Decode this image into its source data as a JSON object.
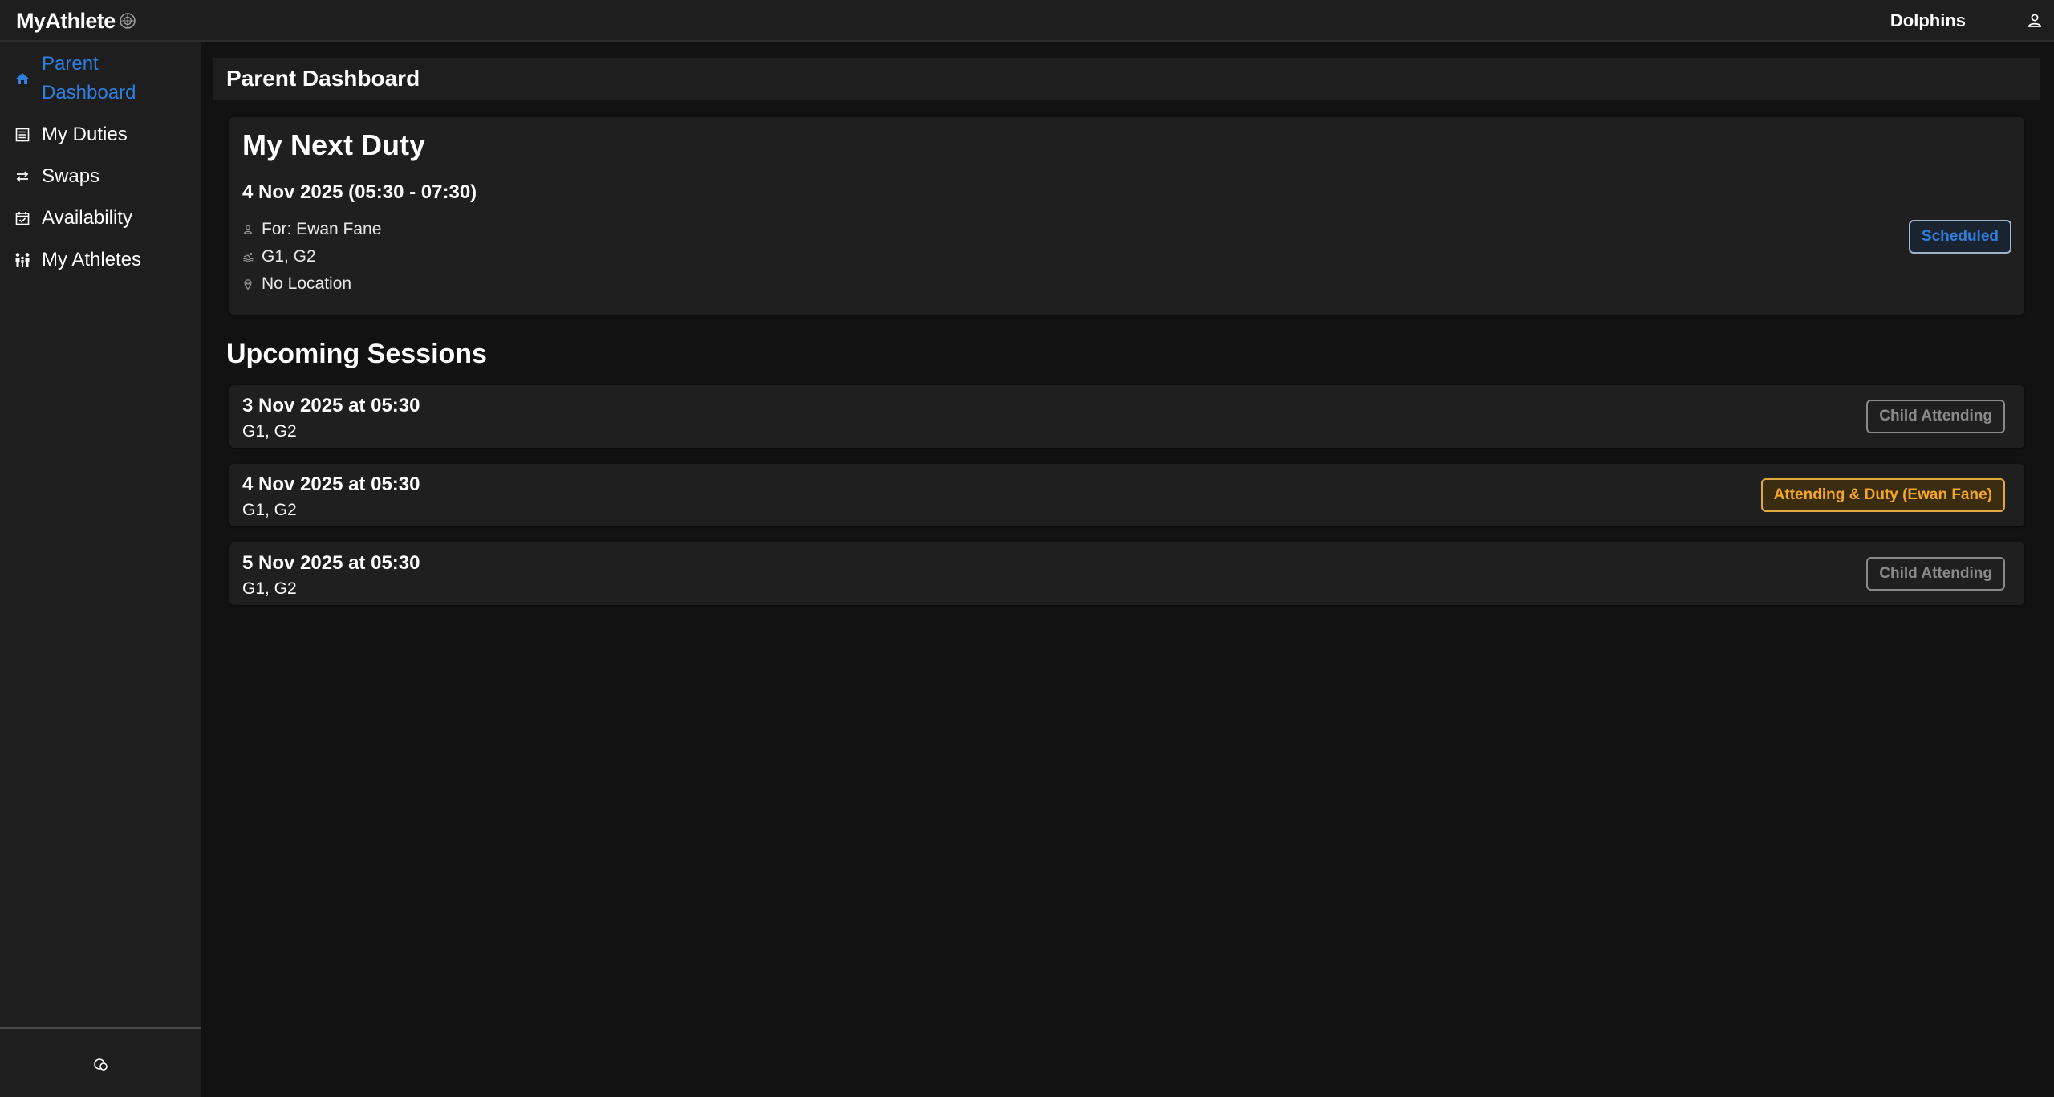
{
  "app": {
    "brand": "MyAthlete",
    "team_name": "Dolphins"
  },
  "sidebar": {
    "items": [
      {
        "label": "Parent Dashboard",
        "icon": "home-icon",
        "active": true
      },
      {
        "label": "My Duties",
        "icon": "list-icon",
        "active": false
      },
      {
        "label": "Swaps",
        "icon": "swap-icon",
        "active": false
      },
      {
        "label": "Availability",
        "icon": "calendar-check-icon",
        "active": false
      },
      {
        "label": "My Athletes",
        "icon": "people-icon",
        "active": false
      }
    ],
    "footer_icon": "theme-toggle-icon"
  },
  "page": {
    "title": "Parent Dashboard"
  },
  "next_duty": {
    "heading": "My Next Duty",
    "date": "4 Nov 2025 (05:30 - 07:30)",
    "for": "For: Ewan Fane",
    "groups": "G1, G2",
    "location": "No Location",
    "status": "Scheduled"
  },
  "upcoming": {
    "title": "Upcoming Sessions",
    "sessions": [
      {
        "date": "3 Nov 2025 at 05:30",
        "groups": "G1, G2",
        "status": "Child Attending"
      },
      {
        "date": "4 Nov 2025 at 05:30",
        "groups": "G1, G2",
        "status": "Attending & Duty (Ewan Fane)"
      },
      {
        "date": "5 Nov 2025 at 05:30",
        "groups": "G1, G2",
        "status": "Child Attending"
      }
    ]
  },
  "colors": {
    "accent": "#2f7fde",
    "warning": "#f5a623",
    "muted": "#8a8a8a",
    "background": "#121212",
    "surface": "#1e1e1e"
  }
}
